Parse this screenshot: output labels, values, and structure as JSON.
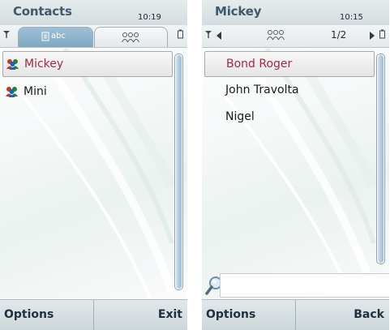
{
  "screens": [
    {
      "title": "Contacts",
      "clock": "10:19",
      "tabs": [
        {
          "label": "abc",
          "icon": "address-book-icon",
          "active": true
        },
        {
          "label": "",
          "icon": "group-icon",
          "active": false
        }
      ],
      "items": [
        {
          "label": "Mickey",
          "icon": "group-icon",
          "selected": true
        },
        {
          "label": "Mini",
          "icon": "group-icon",
          "selected": false
        }
      ],
      "softkeys": {
        "left": "Options",
        "right": "Exit"
      }
    },
    {
      "title": "Mickey",
      "clock": "10:15",
      "page_indicator": "1/2",
      "items": [
        {
          "label": "Bond Roger",
          "selected": true
        },
        {
          "label": "John Travolta",
          "selected": false
        },
        {
          "label": "Nigel",
          "selected": false
        }
      ],
      "search": {
        "value": "",
        "icon": "search-icon"
      },
      "softkeys": {
        "left": "Options",
        "right": "Back"
      }
    }
  ],
  "colors": {
    "title_text": "#3f5a6c",
    "selected_text": "#9c2a45",
    "tab_active": "#8fb3cc",
    "softkey_text": "#1f3040"
  }
}
